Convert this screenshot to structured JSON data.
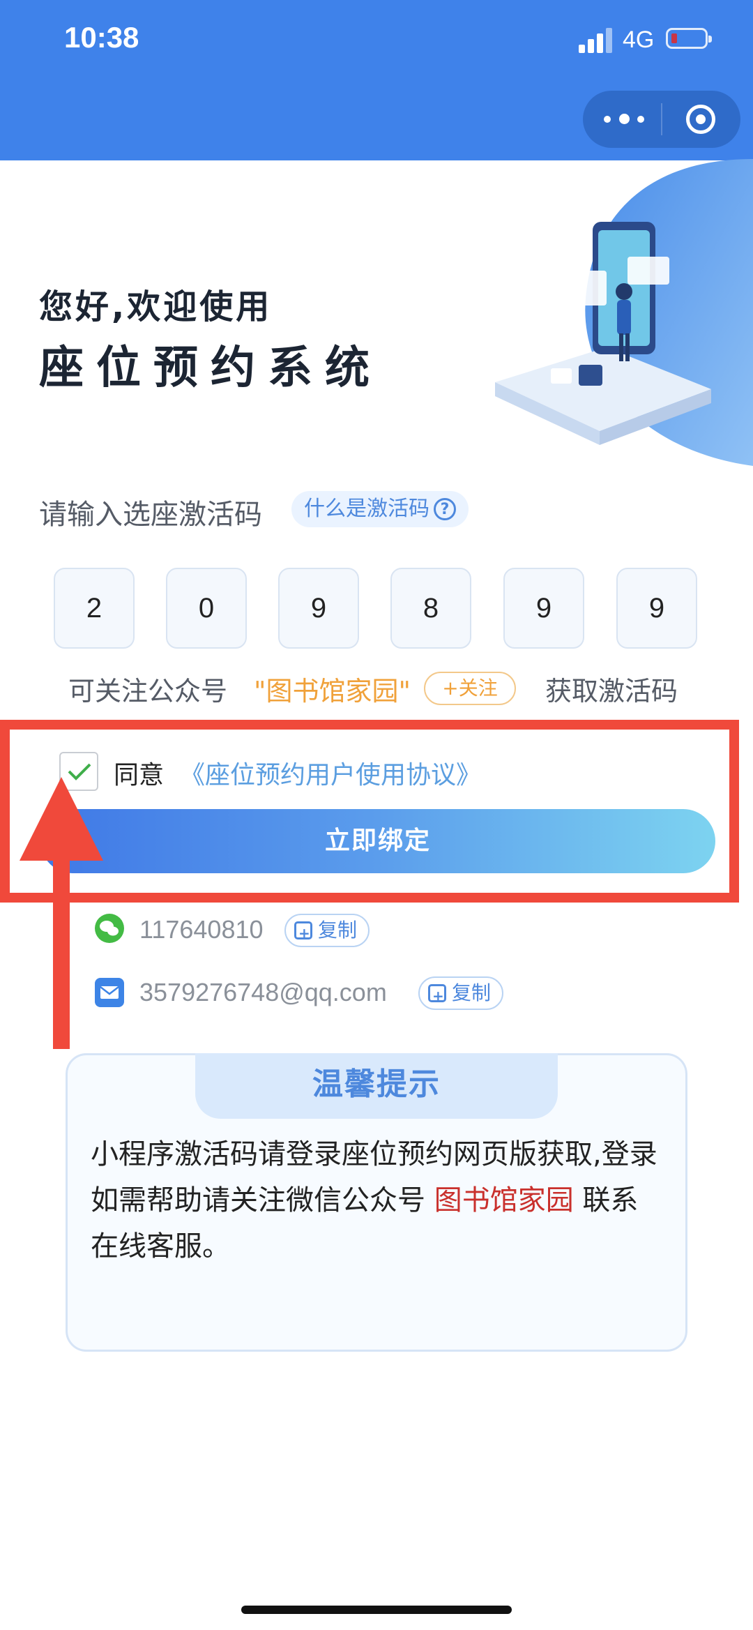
{
  "status_bar": {
    "time": "10:38",
    "network": "4G"
  },
  "greeting": {
    "line1": "您好,欢迎使用",
    "line2": "座位预约系统"
  },
  "activation": {
    "prompt": "请输入选座激活码",
    "what_chip": "什么是激活码",
    "code_digits": [
      "2",
      "0",
      "9",
      "8",
      "9",
      "9"
    ],
    "follow_text": "可关注公众号",
    "account_name": "\"图书馆家园\"",
    "follow_button": "+关注",
    "get_code": "获取激活码"
  },
  "agreement": {
    "agree_label": "同意",
    "link_text": "《座位预约用户使用协议》",
    "checked": true
  },
  "bind_button": "立即绑定",
  "contacts": {
    "wechat": "117640810",
    "email": "3579276748@qq.com",
    "copy_label": "复制"
  },
  "tips": {
    "title": "温馨提示",
    "body_part1": "小程序激活码请登录座位预约网页版获取,登录如需帮助请关注微信公众号 ",
    "body_highlight": "图书馆家园",
    "body_part2": " 联系在线客服。"
  },
  "colors": {
    "primary": "#3f82ea",
    "accent_orange": "#f0a13a",
    "highlight_red": "#f0493b",
    "link_blue": "#5b9ee0"
  }
}
